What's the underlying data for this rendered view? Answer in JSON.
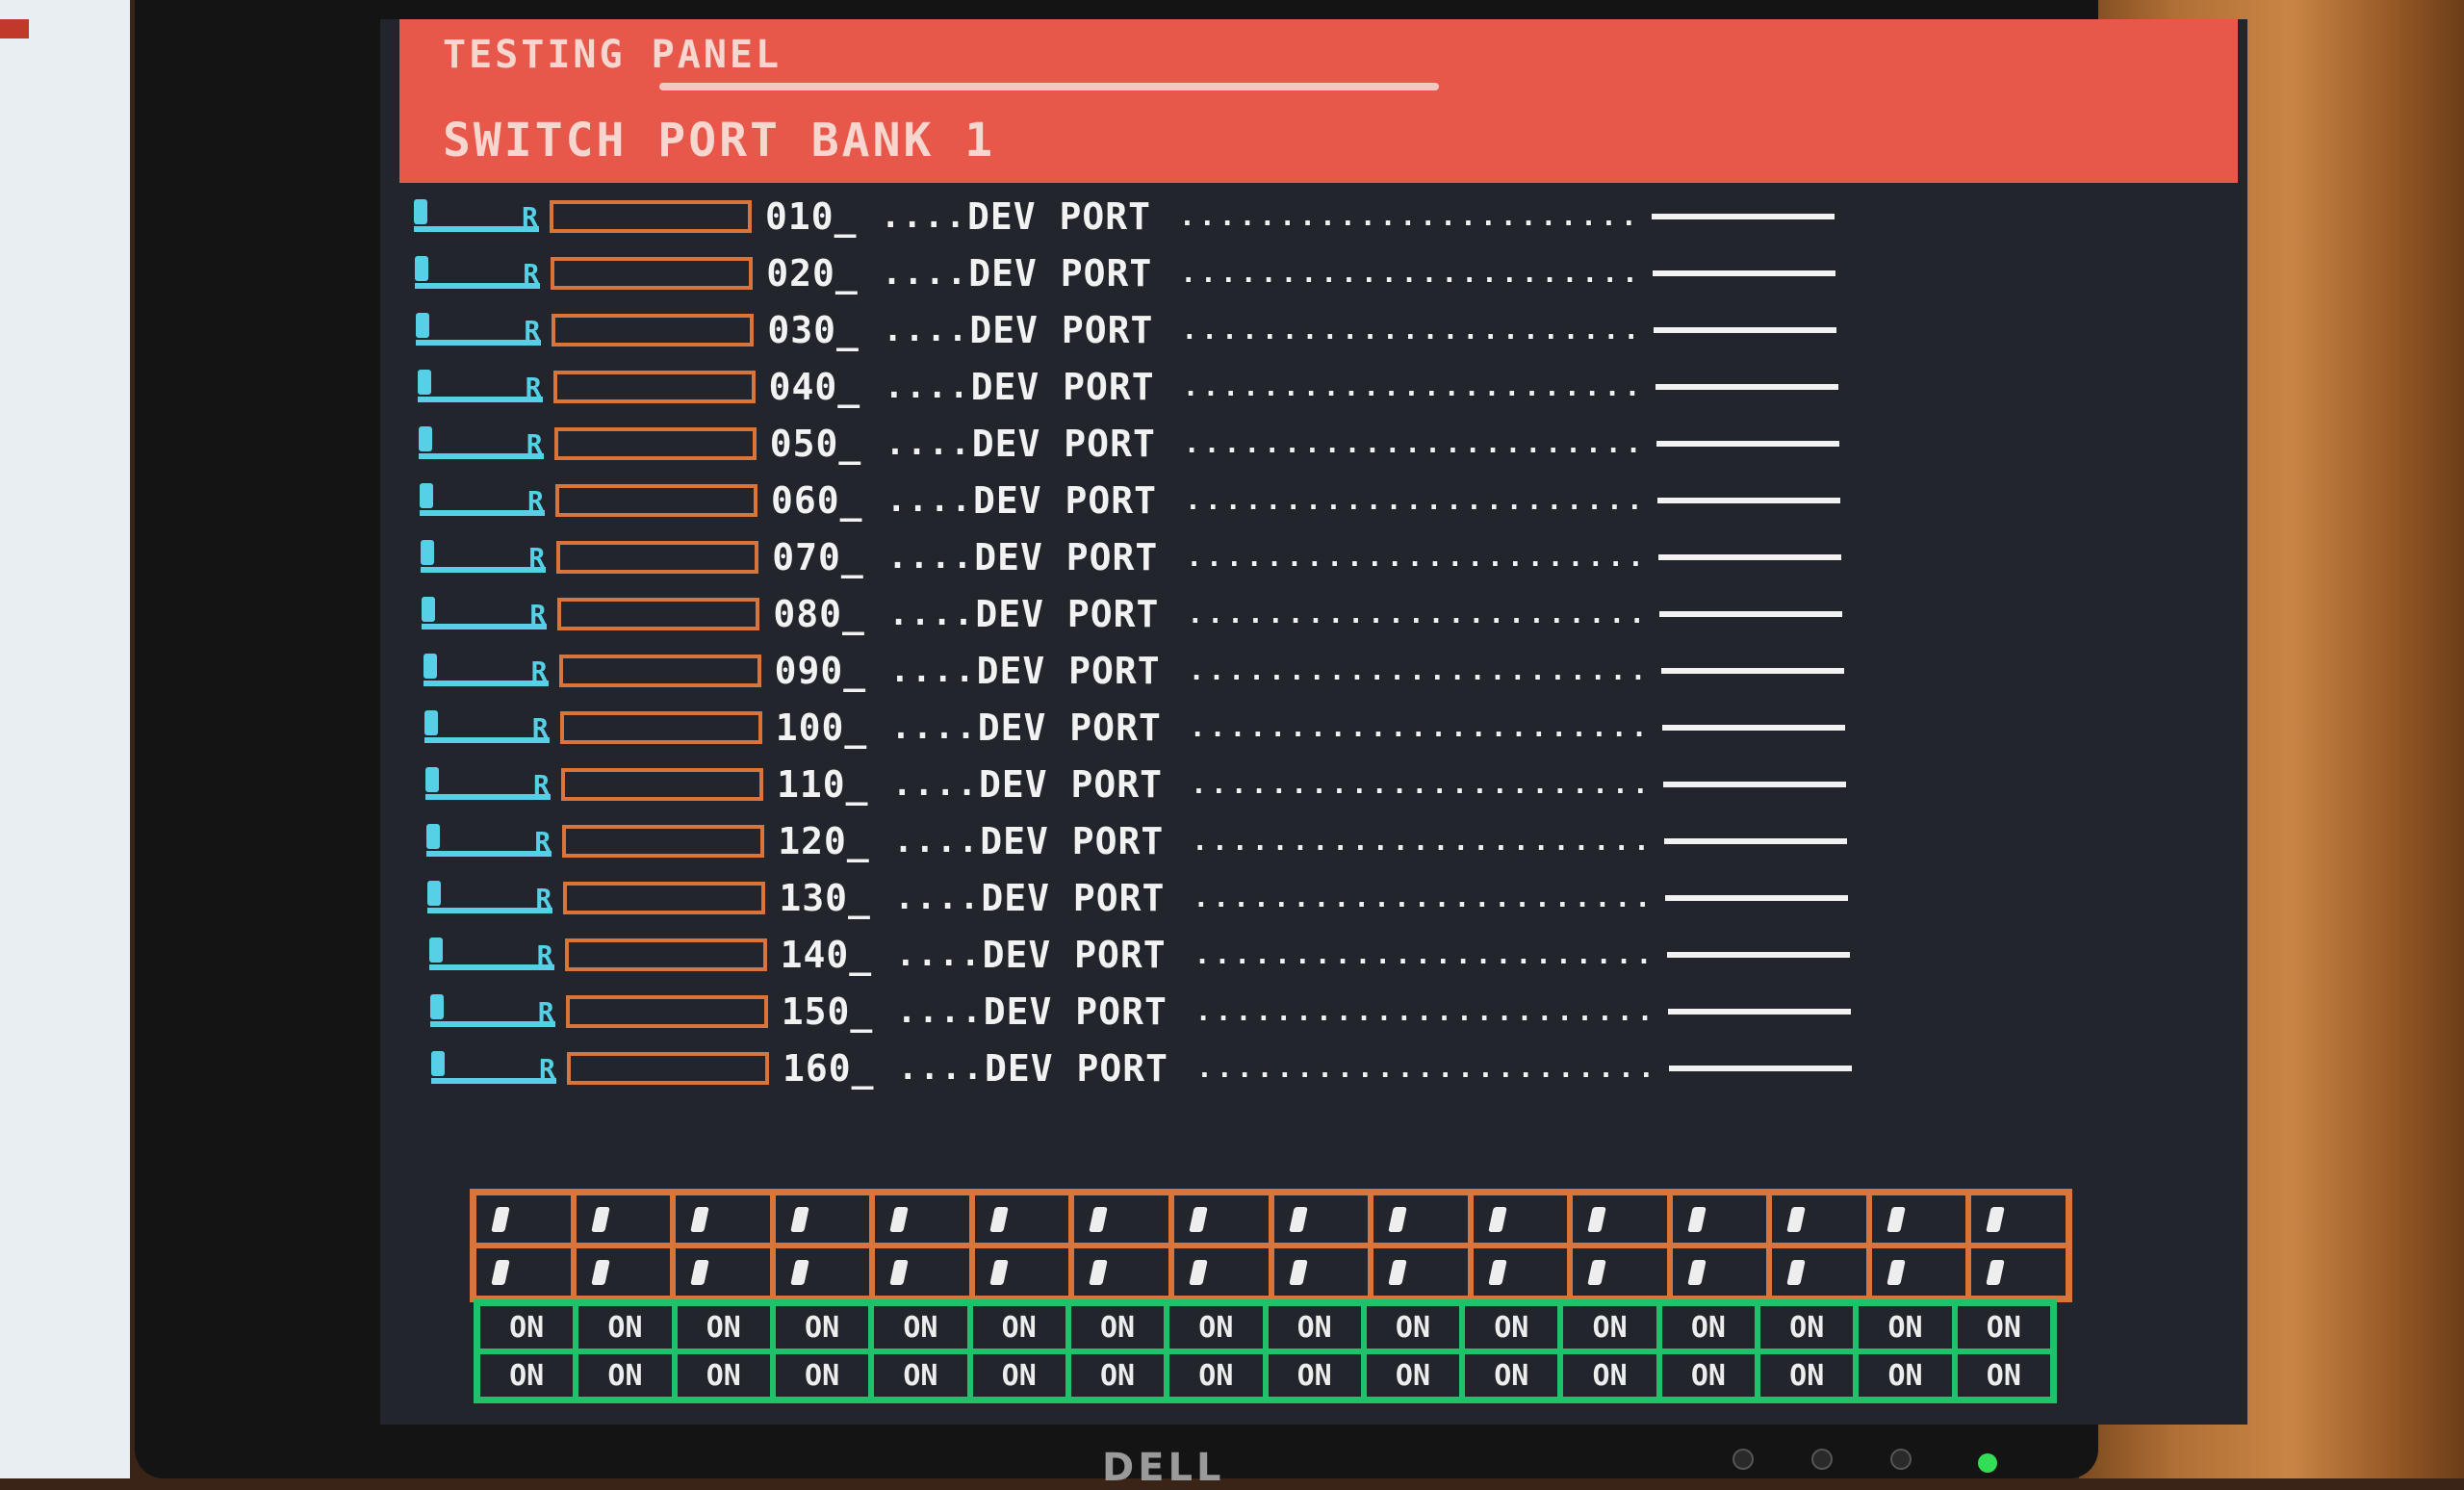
{
  "header": {
    "title": "TESTING PANEL",
    "subtitle": "SWITCH PORT BANK 1"
  },
  "rows": [
    {
      "id": "010_",
      "name": "DEV PORT"
    },
    {
      "id": "020_",
      "name": "DEV PORT"
    },
    {
      "id": "030_",
      "name": "DEV PORT"
    },
    {
      "id": "040_",
      "name": "DEV PORT"
    },
    {
      "id": "050_",
      "name": "DEV PORT"
    },
    {
      "id": "060_",
      "name": "DEV PORT"
    },
    {
      "id": "070_",
      "name": "DEV PORT"
    },
    {
      "id": "080_",
      "name": "DEV PORT"
    },
    {
      "id": "090_",
      "name": "DEV PORT"
    },
    {
      "id": "100_",
      "name": "DEV PORT"
    },
    {
      "id": "110_",
      "name": "DEV PORT"
    },
    {
      "id": "120_",
      "name": "DEV PORT"
    },
    {
      "id": "130_",
      "name": "DEV PORT"
    },
    {
      "id": "140_",
      "name": "DEV PORT"
    },
    {
      "id": "150_",
      "name": "DEV PORT"
    },
    {
      "id": "160_",
      "name": "DEV PORT"
    }
  ],
  "row_separator": "....",
  "row_leader": "..............................",
  "row_end_mark": "R",
  "port_grid": {
    "columns": 16,
    "rows": 2
  },
  "status_grid": {
    "label": "ON",
    "columns": 16,
    "rows": 2
  },
  "monitor": {
    "brand": "DELL"
  },
  "colors": {
    "header": "#e8584a",
    "accent_cyan": "#55d0e6",
    "accent_orange": "#d9743a",
    "accent_green": "#1fc16a",
    "screen_bg": "#22262c"
  }
}
